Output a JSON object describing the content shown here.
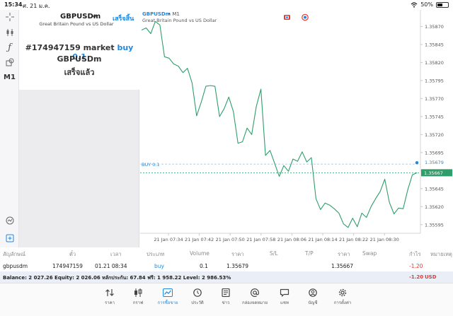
{
  "status_bar": {
    "time": "15:34",
    "date": "ศ. 21 ม.ค.",
    "battery": "50%"
  },
  "left_toolbar": {
    "timeframe": "M1"
  },
  "order_panel": {
    "symbol": "GBPUSDm",
    "done_label": "เสร็จสิ้น",
    "description": "Great Britain Pound vs US Dollar",
    "order_line": "#174947159 market",
    "order_type": "buy 0.1",
    "order_symbol": "GBPUSDm",
    "order_status": "เสร็จแล้ว"
  },
  "chart": {
    "symbol_label": "GBPUSDm",
    "timeframe_label": "• M1",
    "description": "Great Britain Pound vs US Dollar",
    "buy_line_label": "BUY 0.1",
    "current_price_label": "1.35667",
    "buy_price_label": "1.35679"
  },
  "chart_data": {
    "type": "line",
    "x_ticks": [
      "21 Jan 07:34",
      "21 Jan 07:42",
      "21 Jan 07:50",
      "21 Jan 07:58",
      "21 Jan 08:06",
      "21 Jan 08:14",
      "21 Jan 08:22",
      "21 Jan 08:30"
    ],
    "y_ticks": [
      1.35595,
      1.3562,
      1.35645,
      1.3567,
      1.35695,
      1.3572,
      1.35745,
      1.3577,
      1.35795,
      1.3582,
      1.35845,
      1.3587
    ],
    "ylim": [
      1.35583,
      1.35893
    ],
    "buy_level": 1.35679,
    "current_price": 1.35667,
    "close_prices": [
      1.35865,
      1.35868,
      1.3586,
      1.35877,
      1.35872,
      1.35828,
      1.35826,
      1.35818,
      1.35815,
      1.35806,
      1.35812,
      1.35792,
      1.35746,
      1.35765,
      1.35787,
      1.35788,
      1.35787,
      1.35745,
      1.35756,
      1.35772,
      1.35752,
      1.35708,
      1.3571,
      1.35729,
      1.3572,
      1.35759,
      1.35783,
      1.35691,
      1.35698,
      1.3568,
      1.35662,
      1.35677,
      1.35669,
      1.35686,
      1.35683,
      1.35696,
      1.35682,
      1.35688,
      1.35631,
      1.35616,
      1.35625,
      1.35622,
      1.35617,
      1.35611,
      1.35596,
      1.35591,
      1.35604,
      1.35592,
      1.35611,
      1.35605,
      1.3562,
      1.35631,
      1.35641,
      1.35658,
      1.35626,
      1.3561,
      1.35618,
      1.35617,
      1.35643,
      1.35664,
      1.35667
    ]
  },
  "table": {
    "headers": [
      "สัญลักษณ์",
      "ตั๋ว",
      "เวลา",
      "ประเภท",
      "Volume",
      "ราคา",
      "S/L",
      "T/P",
      "ราคา",
      "Swap",
      "กำไร",
      "หมายเหตุ"
    ],
    "row": [
      "gbpusdm",
      "174947159",
      "01.21 08:34",
      "buy",
      "0.1",
      "1.35679",
      "",
      "",
      "1.35667",
      "",
      "-1.20",
      ""
    ]
  },
  "balance": {
    "text": "Balance: 2 027.26 Equity: 2 026.06 หลักประกัน: 67.84 ฟรี: 1 958.22 Level: 2 986.53%",
    "profit": "-1.20",
    "currency": "USD"
  },
  "tabs": [
    {
      "label": "ราคา",
      "icon": "quotes-arrows-icon"
    },
    {
      "label": "กราฟ",
      "icon": "candlestick-icon"
    },
    {
      "label": "การซื้อขาย",
      "icon": "trade-chart-icon",
      "active": true
    },
    {
      "label": "ประวัติ",
      "icon": "history-clock-icon"
    },
    {
      "label": "ข่าว",
      "icon": "news-icon"
    },
    {
      "label": "กล่องจดหมาย",
      "icon": "mailbox-at-icon"
    },
    {
      "label": "แชท",
      "icon": "chat-icon"
    },
    {
      "label": "บัญชี",
      "icon": "account-icon"
    },
    {
      "label": "การตั้งค่า",
      "icon": "settings-gear-icon"
    }
  ],
  "colors": {
    "accent": "#1e88e5",
    "line": "#2e9e6b",
    "loss": "#e53935"
  }
}
